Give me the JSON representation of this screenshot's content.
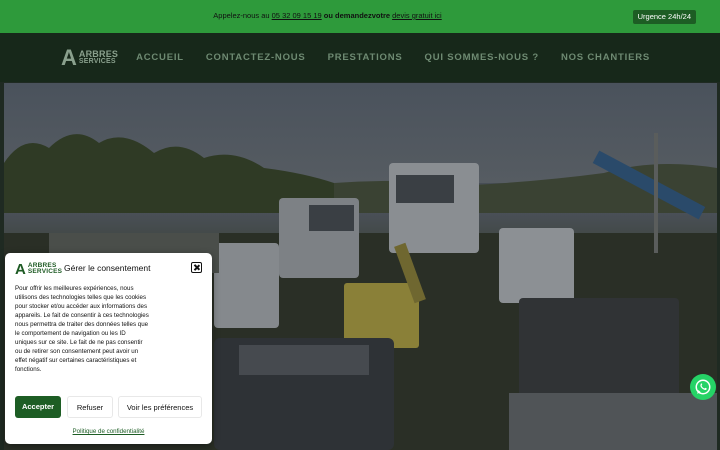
{
  "topbar": {
    "prefix": "Appelez-nous au ",
    "phone": "05 32 09 15 19",
    "middle": " ou demandezvotre ",
    "quote_link": "devis gratuit ici",
    "urgence": "Urgence 24h/24"
  },
  "logo": {
    "letter": "A",
    "line1": "ARBRES",
    "line2": "SERVICES"
  },
  "nav": {
    "items": [
      {
        "label": "ACCUEIL"
      },
      {
        "label": "CONTACTEZ-NOUS"
      },
      {
        "label": "PRESTATIONS"
      },
      {
        "label": "QUI SOMMES-NOUS ?"
      },
      {
        "label": "NOS CHANTIERS"
      }
    ]
  },
  "consent": {
    "title": "Gérer le consentement",
    "body": "Pour offrir les meilleures expériences, nous utilisons des technologies telles que les cookies pour stocker et/ou accéder aux informations des appareils. Le fait de consentir à ces technologies nous permettra de traiter des données telles que le comportement de navigation ou les ID uniques sur ce site. Le fait de ne pas consentir ou de retirer son consentement peut avoir un effet négatif sur certaines caractéristiques et fonctions.",
    "accept": "Accepter",
    "refuse": "Refuser",
    "prefs": "Voir les préférences",
    "policy": "Politique de confidentialité"
  },
  "colors": {
    "brand_green": "#2e9a3b",
    "dark_green": "#1d5d24",
    "header_bg": "#17281a",
    "whatsapp": "#25d366"
  },
  "icons": {
    "close": "close-icon",
    "whatsapp": "whatsapp-icon"
  }
}
